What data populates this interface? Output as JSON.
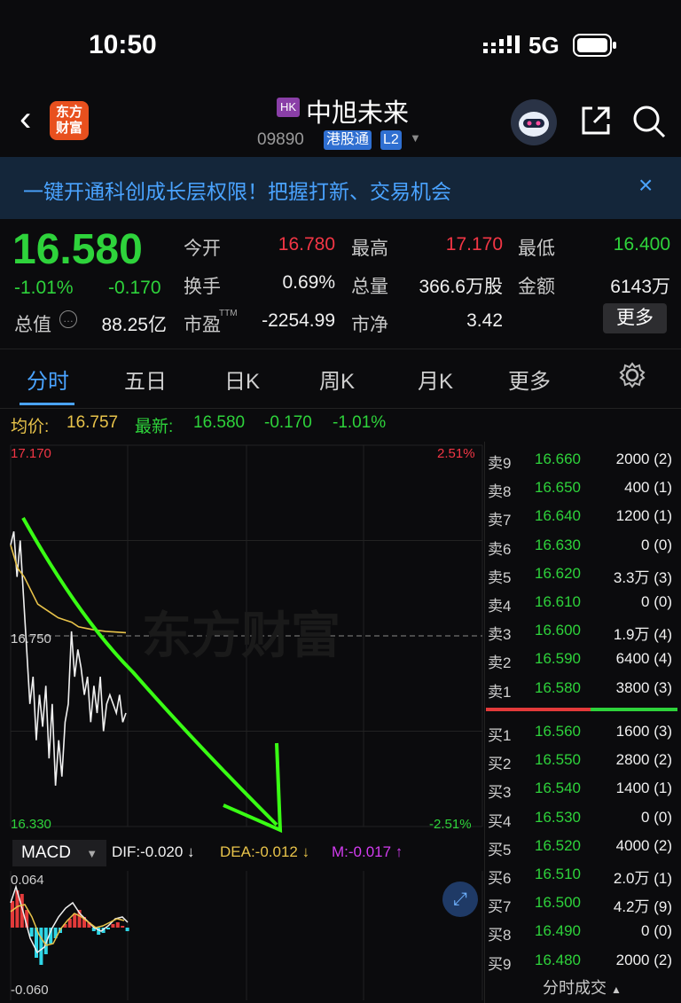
{
  "status_bar": {
    "time": "10:50",
    "network": "5G"
  },
  "nav": {
    "logo_text_line1": "东方",
    "logo_text_line2": "财富",
    "market_badge": "HK",
    "stock_name": "中旭未来",
    "stock_code": "09890",
    "tag_connect": "港股通",
    "tag_level": "L2"
  },
  "banner": {
    "text": "一键开通科创成长层权限！把握打新、交易机会",
    "close": "×"
  },
  "quote": {
    "price": "16.580",
    "change_pct": "-1.01%",
    "change": "-0.170",
    "market_cap_label": "总值",
    "market_cap": "88.25亿",
    "fields": [
      {
        "label": "今开",
        "value": "16.780",
        "color": "#f23645"
      },
      {
        "label": "最高",
        "value": "17.170",
        "color": "#f23645"
      },
      {
        "label": "最低",
        "value": "16.400",
        "color": "#2ed33b"
      },
      {
        "label": "换手",
        "value": "0.69%",
        "color": "#f0f0f0"
      },
      {
        "label": "总量",
        "value": "366.6万股",
        "color": "#f0f0f0"
      },
      {
        "label": "金额",
        "value": "6143万",
        "color": "#f0f0f0"
      },
      {
        "label": "市盈",
        "value": "-2254.99",
        "color": "#f0f0f0"
      },
      {
        "label": "市净",
        "value": "3.42",
        "color": "#f0f0f0"
      }
    ],
    "pe_superscript": "TTM",
    "more_button": "更多"
  },
  "tabs": [
    "分时",
    "五日",
    "日K",
    "周K",
    "月K",
    "更多"
  ],
  "info_line": {
    "avg_label": "均价:",
    "avg_value": "16.757",
    "latest_label": "最新:",
    "latest_value": "16.580",
    "change": "-0.170",
    "change_pct": "-1.01%"
  },
  "chart": {
    "y_top": "17.170",
    "y_mid": "16.750",
    "y_bottom": "16.330",
    "pct_top": "2.51%",
    "pct_bottom": "-2.51%",
    "watermark": "东方财富"
  },
  "chart_data": {
    "type": "line",
    "title": "",
    "series": [
      {
        "values": [
          16.95,
          16.98,
          16.88,
          16.96,
          16.84,
          16.72,
          16.6,
          16.66,
          16.52,
          16.62,
          16.55,
          16.64,
          16.48,
          16.6,
          16.42,
          16.52,
          16.44,
          16.56,
          16.6,
          16.76,
          16.66,
          16.72,
          16.68,
          16.62,
          16.66,
          16.56,
          16.64,
          16.58,
          16.66,
          16.54,
          16.6,
          16.62,
          16.6,
          16.58,
          16.62,
          16.56,
          16.58
        ]
      },
      {
        "values": [
          16.95,
          16.9,
          16.88,
          16.85,
          16.82,
          16.81,
          16.8,
          16.79,
          16.785,
          16.78,
          16.77,
          16.767,
          16.764,
          16.762,
          16.76,
          16.759,
          16.758,
          16.757
        ]
      }
    ],
    "ylim": [
      16.33,
      17.17
    ],
    "reference": 16.75
  },
  "order_book": {
    "asks": [
      {
        "side": "卖9",
        "price": "16.660",
        "vol": "2000 (2)"
      },
      {
        "side": "卖8",
        "price": "16.650",
        "vol": "400 (1)"
      },
      {
        "side": "卖7",
        "price": "16.640",
        "vol": "1200 (1)"
      },
      {
        "side": "卖6",
        "price": "16.630",
        "vol": "0 (0)"
      },
      {
        "side": "卖5",
        "price": "16.620",
        "vol": "3.3万 (3)"
      },
      {
        "side": "卖4",
        "price": "16.610",
        "vol": "0 (0)"
      },
      {
        "side": "卖3",
        "price": "16.600",
        "vol": "1.9万 (4)"
      },
      {
        "side": "卖2",
        "price": "16.590",
        "vol": "6400 (4)"
      },
      {
        "side": "卖1",
        "price": "16.580",
        "vol": "3800 (3)"
      }
    ],
    "bids": [
      {
        "side": "买1",
        "price": "16.560",
        "vol": "1600 (3)"
      },
      {
        "side": "买2",
        "price": "16.550",
        "vol": "2800 (2)"
      },
      {
        "side": "买3",
        "price": "16.540",
        "vol": "1400 (1)"
      },
      {
        "side": "买4",
        "price": "16.530",
        "vol": "0 (0)"
      },
      {
        "side": "买5",
        "price": "16.520",
        "vol": "4000 (2)"
      },
      {
        "side": "买6",
        "price": "16.510",
        "vol": "2.0万 (1)"
      },
      {
        "side": "买7",
        "price": "16.500",
        "vol": "4.2万 (9)"
      },
      {
        "side": "买8",
        "price": "16.490",
        "vol": "0 (0)"
      },
      {
        "side": "买9",
        "price": "16.480",
        "vol": "2000 (2)"
      }
    ]
  },
  "macd": {
    "button": "MACD",
    "dif": "DIF:-0.020 ↓",
    "dea": "DEA:-0.012 ↓",
    "m": "M:-0.017 ↑",
    "y_top": "0.064",
    "y_bottom": "-0.060"
  },
  "bottom_tab": "分时成交"
}
